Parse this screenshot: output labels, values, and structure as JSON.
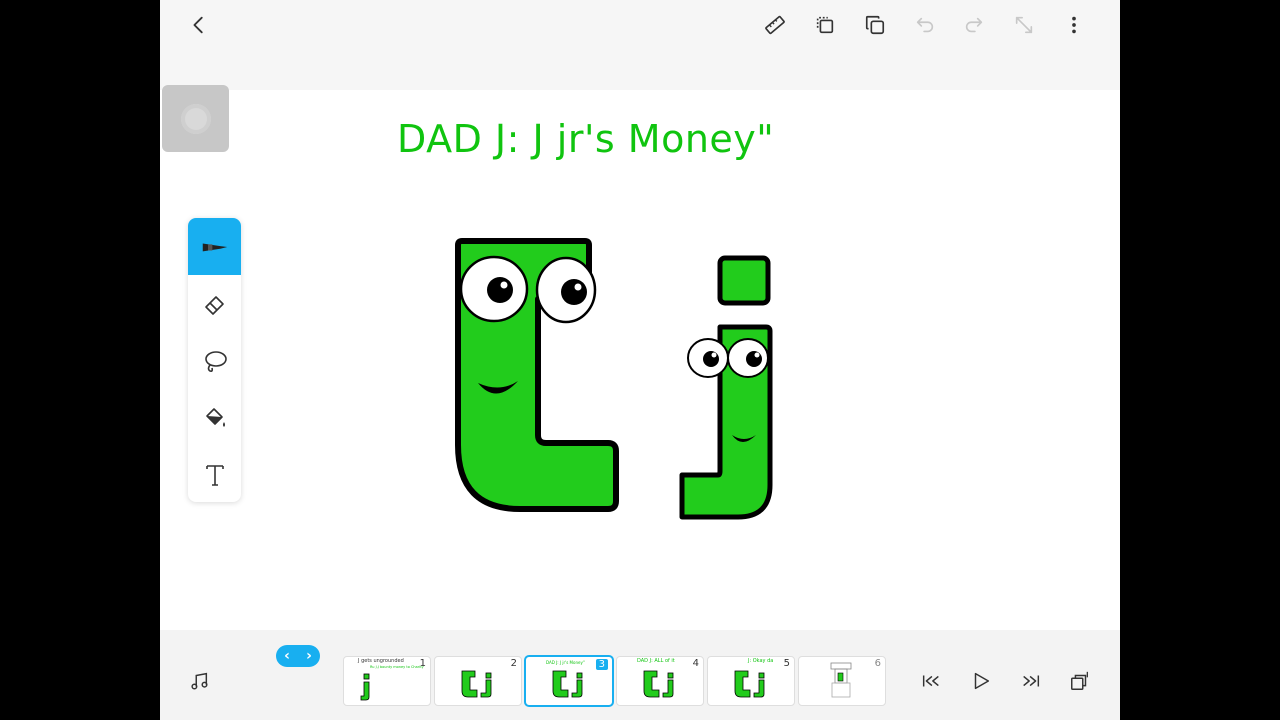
{
  "canvas": {
    "title": "DAD J: J jr's Money\""
  },
  "toolbar": {
    "icons": [
      "back-icon",
      "ruler-icon",
      "copy-frame-icon",
      "duplicate-icon",
      "undo-icon",
      "redo-icon",
      "expand-icon",
      "more-icon"
    ]
  },
  "tools": [
    "pen-icon",
    "eraser-icon",
    "lasso-icon",
    "fill-bucket-icon",
    "text-icon"
  ],
  "timeline": {
    "frames": [
      {
        "num": "1",
        "caption": "J gets ungrounded",
        "caption2": "Ru J.J bounty money to Charity",
        "style": "small"
      },
      {
        "num": "2",
        "caption": "",
        "style": "two"
      },
      {
        "num": "3",
        "caption": "DAD J: J jr's Money\"",
        "style": "two"
      },
      {
        "num": "4",
        "caption": "DAD J: ALL of it",
        "style": "two"
      },
      {
        "num": "5",
        "caption": "J: Okay da",
        "style": "two"
      },
      {
        "num": "6",
        "caption": "",
        "style": "device"
      }
    ],
    "selected_frame": "3"
  },
  "colors": {
    "accent": "#18aff0",
    "letter_green": "#22cc1c",
    "title_green": "#10c40f"
  }
}
